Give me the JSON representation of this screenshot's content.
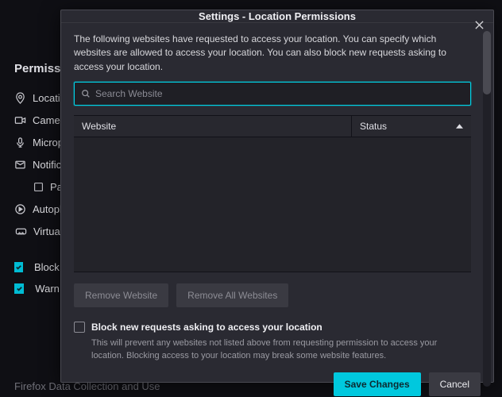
{
  "background": {
    "section_heading": "Permissions",
    "items": [
      {
        "icon": "location",
        "label": "Location"
      },
      {
        "icon": "camera",
        "label": "Camera"
      },
      {
        "icon": "microphone",
        "label": "Microphone"
      },
      {
        "icon": "notifications",
        "label": "Notifications"
      },
      {
        "icon": "pause",
        "label": "Pause",
        "sub": true
      },
      {
        "icon": "autoplay",
        "label": "Autoplay"
      },
      {
        "icon": "vr",
        "label": "Virtual"
      }
    ],
    "check1": "Block p",
    "check2": "Warn y",
    "footer": "Firefox Data Collection and Use"
  },
  "modal": {
    "title": "Settings - Location Permissions",
    "intro": "The following websites have requested to access your location. You can specify which websites are allowed to access your location. You can also block new requests asking to access your location.",
    "search_placeholder": "Search Website",
    "cols": {
      "website": "Website",
      "status": "Status"
    },
    "rows": [],
    "remove_btn": "Remove Website",
    "remove_all_btn": "Remove All Websites",
    "block_label": "Block new requests asking to access your location",
    "block_desc": "This will prevent any websites not listed above from requesting permission to access your location. Blocking access to your location may break some website features.",
    "save": "Save Changes",
    "cancel": "Cancel"
  },
  "colors": {
    "accent": "#00c8de"
  }
}
